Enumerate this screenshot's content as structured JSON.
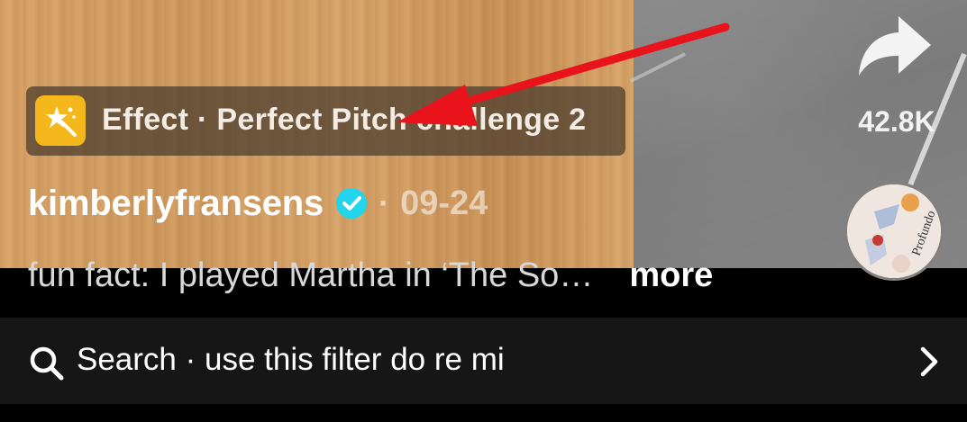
{
  "effect": {
    "label": "Effect · Perfect Pitch challenge 2",
    "icon": "effect-sparkle-icon",
    "icon_color": "#f5b81c"
  },
  "author": {
    "username": "kimberlyfransens",
    "verified": true,
    "verified_color": "#20d5ec",
    "separator": "·",
    "date": "09-24"
  },
  "caption": {
    "text": "fun fact: I played Martha in ‘The So…",
    "more_label": "more"
  },
  "share": {
    "icon": "share-arrow-icon",
    "count": "42.8K"
  },
  "sound": {
    "disc_text": "Profundo"
  },
  "search": {
    "icon": "search-icon",
    "label": "Search · use this filter do re mi",
    "chevron": "chevron-right-icon"
  },
  "annotation": {
    "arrow_color": "#e8131b"
  }
}
